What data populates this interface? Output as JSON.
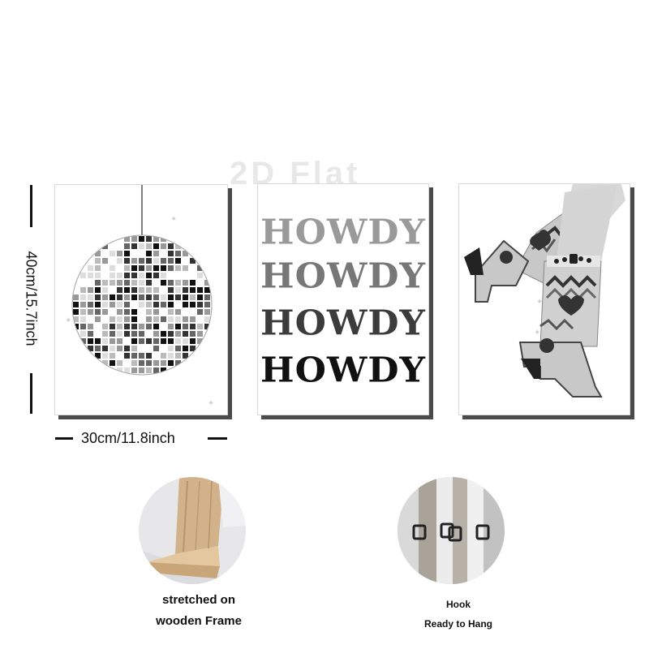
{
  "watermark": "2D Flat",
  "dimensions": {
    "height_label": "40cm/15.7inch",
    "width_label": "30cm/11.8inch"
  },
  "panels": [
    {
      "subject": "disco-ball"
    },
    {
      "subject": "howdy-text",
      "lines": [
        "HOWDY",
        "HOWDY",
        "HOWDY",
        "HOWDY"
      ]
    },
    {
      "subject": "cowboy-boots"
    }
  ],
  "features": {
    "frame": {
      "line1": "stretched on",
      "line2": "wooden Frame"
    },
    "hook": {
      "line1": "Hook",
      "line2": "Ready to Hang"
    }
  },
  "colors": {
    "shadow": "#4a4a4a",
    "light_gray": "#c8c8c8",
    "dark": "#222222"
  }
}
